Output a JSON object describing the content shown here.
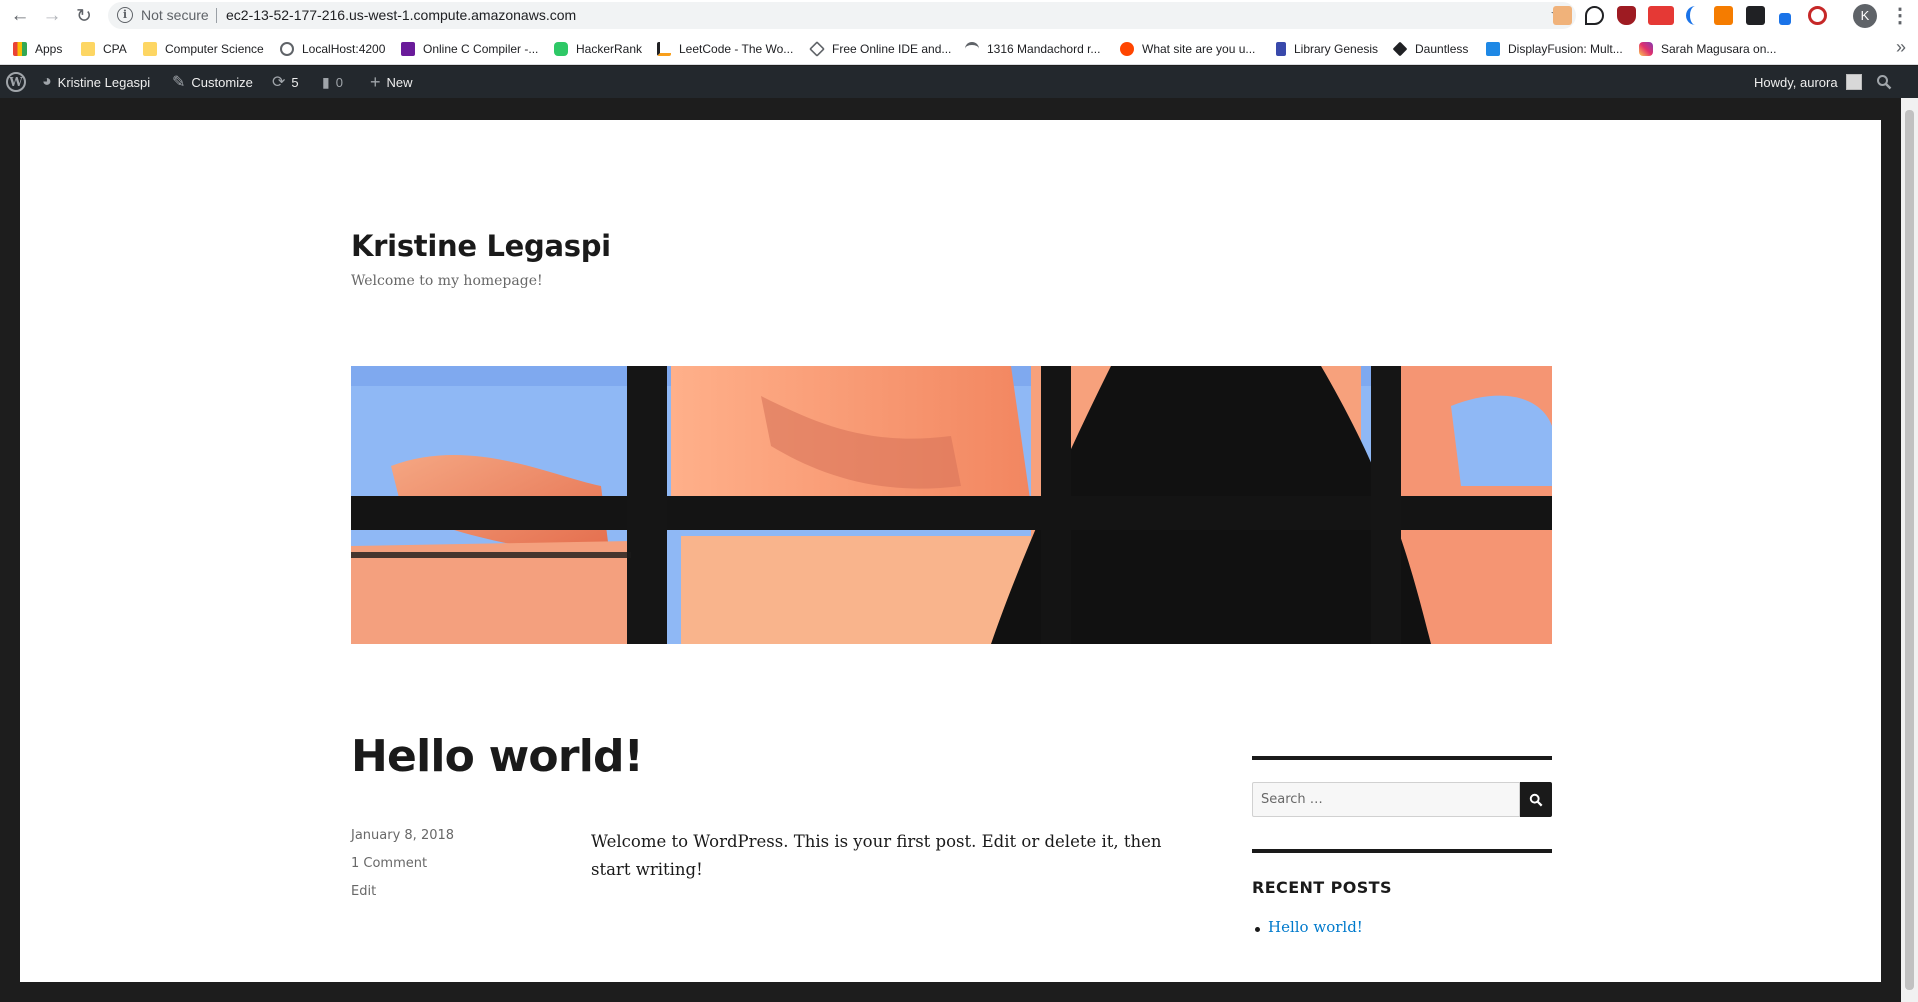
{
  "browser": {
    "security_label": "Not secure",
    "url": "ec2-13-52-177-216.us-west-1.compute.amazonaws.com",
    "profile_initial": "K",
    "bookmarks": [
      {
        "label": "Apps",
        "icon": "apps-grid-icon"
      },
      {
        "label": "CPA",
        "icon": "folder-icon"
      },
      {
        "label": "Computer Science",
        "icon": "folder-icon"
      },
      {
        "label": "LocalHost:4200",
        "icon": "globe-icon"
      },
      {
        "label": "Online C Compiler -...",
        "icon": "compiler-icon"
      },
      {
        "label": "HackerRank",
        "icon": "hackerrank-icon"
      },
      {
        "label": "LeetCode - The Wo...",
        "icon": "leetcode-icon"
      },
      {
        "label": "Free Online IDE and...",
        "icon": "ide-icon"
      },
      {
        "label": "1316 Mandachord r...",
        "icon": "mandachord-icon"
      },
      {
        "label": "What site are you u...",
        "icon": "reddit-icon"
      },
      {
        "label": "Library Genesis",
        "icon": "libgen-icon"
      },
      {
        "label": "Dauntless",
        "icon": "dauntless-icon"
      },
      {
        "label": "DisplayFusion: Mult...",
        "icon": "displayfusion-icon"
      },
      {
        "label": "Sarah Magusara on...",
        "icon": "instagram-icon"
      }
    ]
  },
  "adminbar": {
    "site_name": "Kristine Legaspi",
    "customize": "Customize",
    "updates_count": "5",
    "comments_count": "0",
    "new_label": "New",
    "greeting": "Howdy, aurora"
  },
  "site": {
    "title": "Kristine Legaspi",
    "description": "Welcome to my homepage!"
  },
  "post": {
    "title": "Hello world!",
    "date": "January 8, 2018",
    "comments": "1 Comment",
    "edit": "Edit",
    "body": "Welcome to WordPress. This is your first post. Edit or delete it, then start writing!"
  },
  "sidebar": {
    "search_placeholder": "Search …",
    "recent_posts_title": "RECENT POSTS",
    "recent_posts": [
      "Hello world!"
    ]
  },
  "colors": {
    "admin_bar": "#23282d",
    "link": "#007acc",
    "text": "#1a1a1a"
  }
}
